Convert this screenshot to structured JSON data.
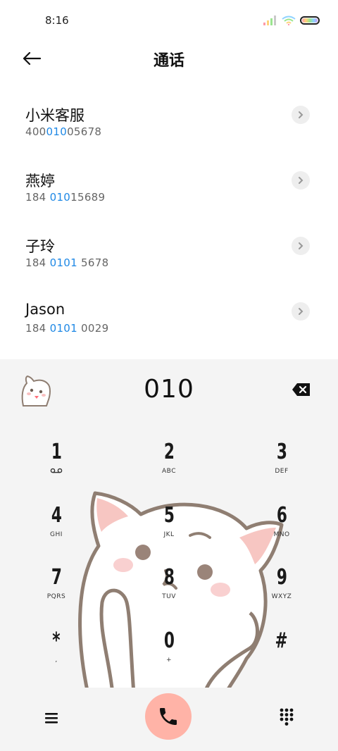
{
  "status": {
    "time": "8:16"
  },
  "header": {
    "title": "通话"
  },
  "contacts": [
    {
      "name": "小米客服",
      "number_pre": "400",
      "number_hl": "010",
      "number_post": "05678"
    },
    {
      "name": "燕婷",
      "number_pre": "184 ",
      "number_hl": "010",
      "number_post": "15689"
    },
    {
      "name": "子玲",
      "number_pre": "184 ",
      "number_hl": "0101",
      "number_post": " 5678"
    },
    {
      "name": "Jason",
      "number_pre": "184 ",
      "number_hl": "0101",
      "number_post": " 0029"
    }
  ],
  "dialer": {
    "input": "010",
    "keys": [
      {
        "digit": "1",
        "sub": ""
      },
      {
        "digit": "2",
        "sub": "ABC"
      },
      {
        "digit": "3",
        "sub": "DEF"
      },
      {
        "digit": "4",
        "sub": "GHI"
      },
      {
        "digit": "5",
        "sub": "JKL"
      },
      {
        "digit": "6",
        "sub": "MNO"
      },
      {
        "digit": "7",
        "sub": "PQRS"
      },
      {
        "digit": "8",
        "sub": "TUV"
      },
      {
        "digit": "9",
        "sub": "WXYZ"
      },
      {
        "digit": "*",
        "sub": ","
      },
      {
        "digit": "0",
        "sub": "+"
      },
      {
        "digit": "#",
        "sub": ""
      }
    ]
  },
  "colors": {
    "highlight": "#1e88e5",
    "call_button": "#ffb3a7",
    "dialer_bg": "#f4f4f4"
  },
  "icons": [
    "signal-icon",
    "wifi-icon",
    "battery-icon",
    "back-arrow-icon",
    "chevron-right-icon",
    "cat-avatar-icon",
    "backspace-icon",
    "voicemail-icon",
    "menu-icon",
    "phone-icon",
    "keypad-icon"
  ]
}
